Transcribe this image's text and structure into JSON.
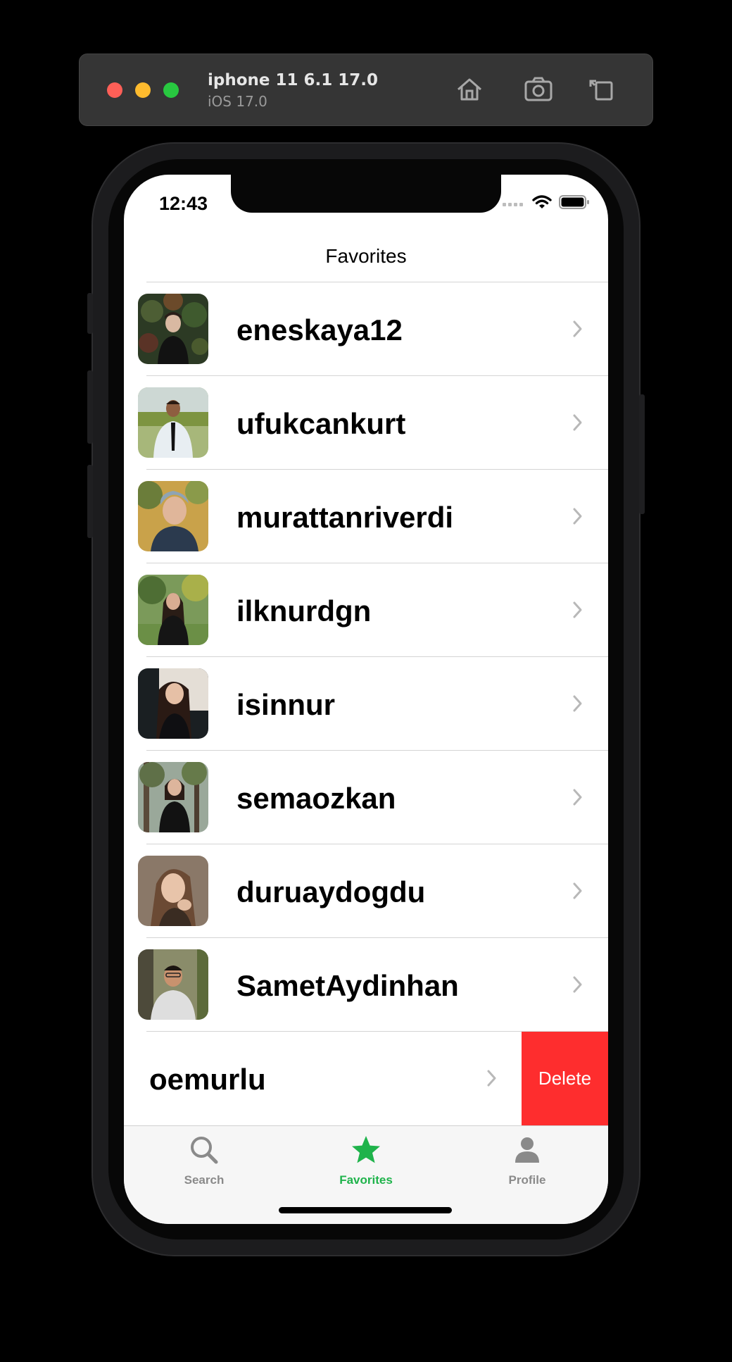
{
  "simulator": {
    "device_name": "iphone 11 6.1 17.0",
    "os_version": "iOS 17.0",
    "buttons": [
      {
        "icon": "home-icon"
      },
      {
        "icon": "screenshot-icon"
      },
      {
        "icon": "rotate-icon"
      }
    ]
  },
  "status_bar": {
    "time": "12:43",
    "icons": [
      "signal-icon",
      "wifi-icon",
      "battery-icon"
    ]
  },
  "nav": {
    "title": "Favorites"
  },
  "favorites": [
    {
      "username": "eneskaya12",
      "avatar_icon": "avatar-photo"
    },
    {
      "username": "ufukcankurt",
      "avatar_icon": "avatar-photo"
    },
    {
      "username": "murattanriverdi",
      "avatar_icon": "avatar-photo"
    },
    {
      "username": "ilknurdgn",
      "avatar_icon": "avatar-photo"
    },
    {
      "username": "isinnur",
      "avatar_icon": "avatar-photo"
    },
    {
      "username": "semaozkan",
      "avatar_icon": "avatar-photo"
    },
    {
      "username": "duruaydogdu",
      "avatar_icon": "avatar-photo"
    },
    {
      "username": "SametAydinhan",
      "avatar_icon": "avatar-photo"
    }
  ],
  "swiped_row": {
    "username": "oemurlu",
    "delete_label": "Delete"
  },
  "tabbar": {
    "tabs": [
      {
        "label": "Search",
        "icon": "search-icon",
        "active": false
      },
      {
        "label": "Favorites",
        "icon": "star-icon",
        "active": true
      },
      {
        "label": "Profile",
        "icon": "person-icon",
        "active": false
      }
    ]
  },
  "colors": {
    "accent": "#1fb34b",
    "delete": "#fe2d2e",
    "inactive_tab": "#8a8a8a"
  }
}
